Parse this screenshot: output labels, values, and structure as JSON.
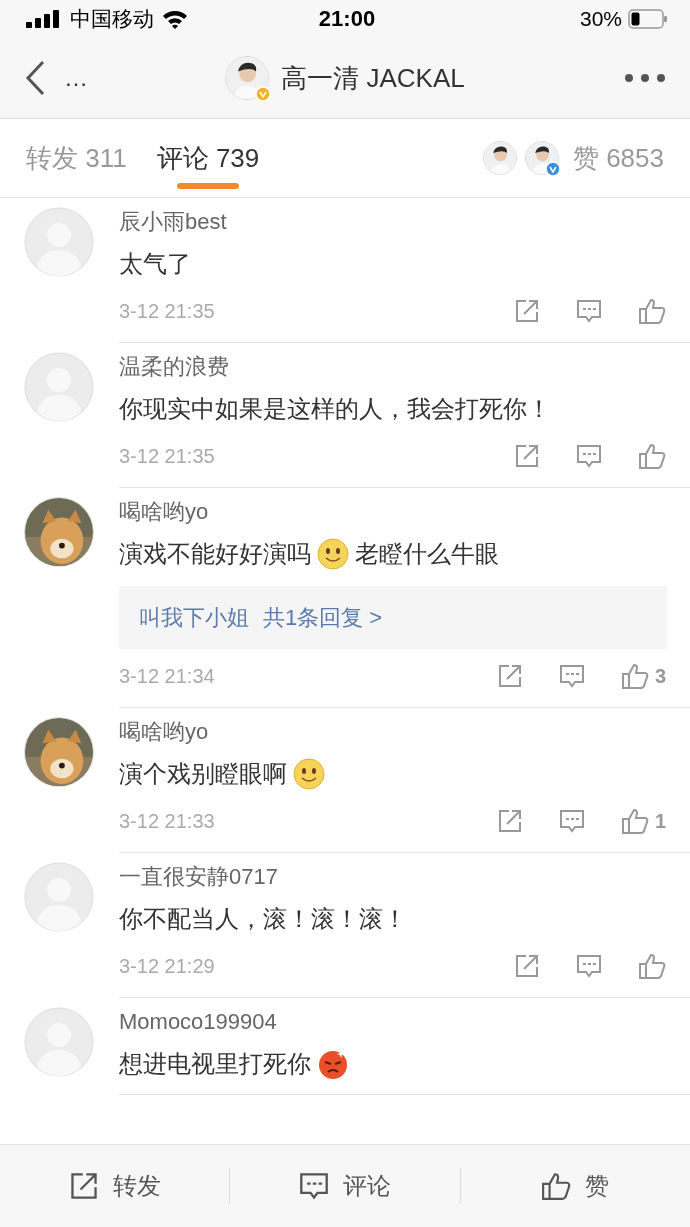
{
  "status_bar": {
    "carrier": "中国移动",
    "time": "21:00",
    "battery": "30%"
  },
  "nav": {
    "more": "…",
    "title": "高一清 JACKAL",
    "verified": true
  },
  "tabs": [
    {
      "label": "转发 311",
      "selected": false
    },
    {
      "label": "评论 739",
      "selected": true
    }
  ],
  "likes_summary": {
    "label": "赞 6853",
    "avatars": [
      {
        "verified": false
      },
      {
        "verified": true
      }
    ]
  },
  "comments": [
    {
      "avatar": {
        "kind": "default"
      },
      "name": "辰小雨best",
      "parts": [
        {
          "kind": "text",
          "text": "太气了"
        }
      ],
      "time": "3-12 21:35"
    },
    {
      "avatar": {
        "kind": "default"
      },
      "name": "温柔的浪费",
      "parts": [
        {
          "kind": "text",
          "text": "你现实中如果是这样的人，我会打死你！"
        }
      ],
      "time": "3-12 21:35"
    },
    {
      "avatar": {
        "kind": "picture"
      },
      "name": "喝啥哟yo",
      "parts": [
        {
          "kind": "text",
          "text": "演戏不能好好演吗"
        },
        {
          "kind": "smile"
        },
        {
          "kind": "text",
          "text": "老瞪什么牛眼"
        }
      ],
      "reply": {
        "name": "叫我下小姐",
        "summary": "共1条回复 >"
      },
      "time": "3-12 21:34",
      "likes": "3"
    },
    {
      "avatar": {
        "kind": "picture"
      },
      "name": "喝啥哟yo",
      "parts": [
        {
          "kind": "text",
          "text": "演个戏别瞪眼啊"
        },
        {
          "kind": "smile"
        }
      ],
      "time": "3-12 21:33",
      "likes": "1"
    },
    {
      "avatar": {
        "kind": "default"
      },
      "name": "一直很安静0717",
      "parts": [
        {
          "kind": "text",
          "text": "你不配当人，滚！滚！滚！"
        }
      ],
      "time": "3-12 21:29"
    },
    {
      "avatar": {
        "kind": "default"
      },
      "name": "Momoco199904",
      "parts": [
        {
          "kind": "text",
          "text": "想进电视里打死你"
        },
        {
          "kind": "angry"
        }
      ]
    }
  ],
  "bottom_bar": [
    "转发",
    "评论",
    "赞"
  ]
}
